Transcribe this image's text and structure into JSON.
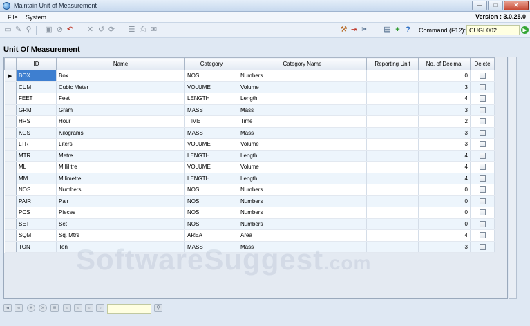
{
  "window": {
    "title": "Maintain Unit of Measurement",
    "min": "—",
    "max": "□",
    "close": "✕"
  },
  "menu": {
    "items": [
      "File",
      "System"
    ],
    "version": "Version : 3.0.25.0"
  },
  "toolbar": {
    "icons": [
      "new-doc-icon",
      "edit-icon",
      "find-icon",
      "save-icon",
      "cancel-icon",
      "undo-icon",
      "delete-icon",
      "back-icon",
      "refresh-icon",
      "list-icon",
      "print-icon",
      "email-icon",
      "tools-icon",
      "exit-icon",
      "settings-icon",
      "window-icon",
      "add-icon",
      "help-icon"
    ],
    "command_label": "Command (F12):",
    "command_value": "CUGL002",
    "go": "▶"
  },
  "section_title": "Unit Of Measurement",
  "grid": {
    "columns": [
      "ID",
      "Name",
      "Category",
      "Category Name",
      "Reporting Unit",
      "No. of Decimal",
      "Delete"
    ],
    "rows": [
      {
        "id": "BOX",
        "name": "Box",
        "category": "NOS",
        "category_name": "Numbers",
        "reporting_unit": "",
        "decimals": "0"
      },
      {
        "id": "CUM",
        "name": "Cubic Meter",
        "category": "VOLUME",
        "category_name": "Volume",
        "reporting_unit": "",
        "decimals": "3"
      },
      {
        "id": "FEET",
        "name": "Feet",
        "category": "LENGTH",
        "category_name": "Length",
        "reporting_unit": "",
        "decimals": "4"
      },
      {
        "id": "GRM",
        "name": "Gram",
        "category": "MASS",
        "category_name": "Mass",
        "reporting_unit": "",
        "decimals": "3"
      },
      {
        "id": "HRS",
        "name": "Hour",
        "category": "TIME",
        "category_name": "Time",
        "reporting_unit": "",
        "decimals": "2"
      },
      {
        "id": "KGS",
        "name": "Kilograms",
        "category": "MASS",
        "category_name": "Mass",
        "reporting_unit": "",
        "decimals": "3"
      },
      {
        "id": "LTR",
        "name": "Liters",
        "category": "VOLUME",
        "category_name": "Volume",
        "reporting_unit": "",
        "decimals": "3"
      },
      {
        "id": "MTR",
        "name": "Metre",
        "category": "LENGTH",
        "category_name": "Length",
        "reporting_unit": "",
        "decimals": "4"
      },
      {
        "id": "ML",
        "name": "Millilitre",
        "category": "VOLUME",
        "category_name": "Volume",
        "reporting_unit": "",
        "decimals": "4"
      },
      {
        "id": "MM",
        "name": "Milimetre",
        "category": "LENGTH",
        "category_name": "Length",
        "reporting_unit": "",
        "decimals": "4"
      },
      {
        "id": "NOS",
        "name": "Numbers",
        "category": "NOS",
        "category_name": "Numbers",
        "reporting_unit": "",
        "decimals": "0"
      },
      {
        "id": "PAIR",
        "name": "Pair",
        "category": "NOS",
        "category_name": "Numbers",
        "reporting_unit": "",
        "decimals": "0"
      },
      {
        "id": "PCS",
        "name": "Pieces",
        "category": "NOS",
        "category_name": "Numbers",
        "reporting_unit": "",
        "decimals": "0"
      },
      {
        "id": "SET",
        "name": "Set",
        "category": "NOS",
        "category_name": "Numbers",
        "reporting_unit": "",
        "decimals": "0"
      },
      {
        "id": "SQM",
        "name": "Sq. Mtrs",
        "category": "AREA",
        "category_name": "Area",
        "reporting_unit": "",
        "decimals": "4"
      },
      {
        "id": "TON",
        "name": "Ton",
        "category": "MASS",
        "category_name": "Mass",
        "reporting_unit": "",
        "decimals": "3"
      }
    ],
    "selected_row": 0,
    "row_indicator": "▶"
  },
  "watermark": {
    "main": "SoftwareSuggest",
    "suffix": ".com"
  },
  "colors": {
    "selection": "#3e7fd0",
    "accent": "#35a635",
    "command_bg": "#ffffe1"
  }
}
